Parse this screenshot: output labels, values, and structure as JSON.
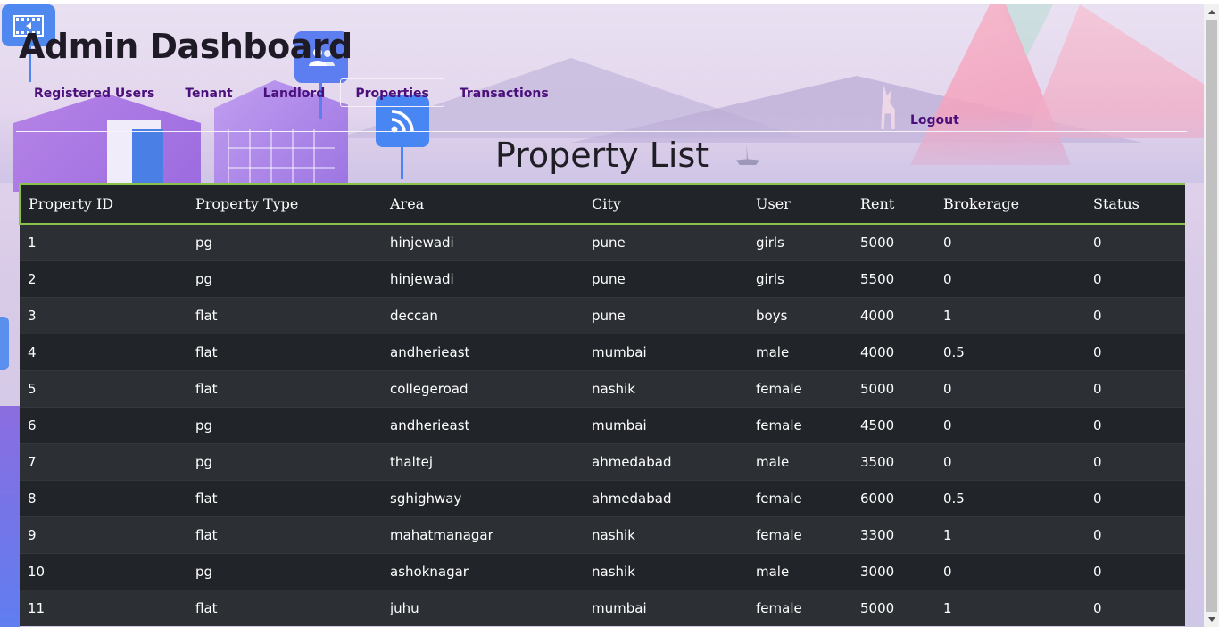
{
  "header": {
    "title": "Admin Dashboard",
    "nav": [
      {
        "label": "Registered Users",
        "active": false
      },
      {
        "label": "Tenant",
        "active": false
      },
      {
        "label": "Landlord",
        "active": false
      },
      {
        "label": "Properties",
        "active": true
      },
      {
        "label": "Transactions",
        "active": false
      }
    ],
    "logout_label": "Logout"
  },
  "main": {
    "page_title": "Property List",
    "table": {
      "columns": [
        "Property ID",
        "Property Type",
        "Area",
        "City",
        "User",
        "Rent",
        "Brokerage",
        "Status"
      ],
      "rows": [
        [
          "1",
          "pg",
          "hinjewadi",
          "pune",
          "girls",
          "5000",
          "0",
          "0"
        ],
        [
          "2",
          "pg",
          "hinjewadi",
          "pune",
          "girls",
          "5500",
          "0",
          "0"
        ],
        [
          "3",
          "flat",
          "deccan",
          "pune",
          "boys",
          "4000",
          "1",
          "0"
        ],
        [
          "4",
          "flat",
          "andherieast",
          "mumbai",
          "male",
          "4000",
          "0.5",
          "0"
        ],
        [
          "5",
          "flat",
          "collegeroad",
          "nashik",
          "female",
          "5000",
          "0",
          "0"
        ],
        [
          "6",
          "pg",
          "andherieast",
          "mumbai",
          "female",
          "4500",
          "0",
          "0"
        ],
        [
          "7",
          "pg",
          "thaltej",
          "ahmedabad",
          "male",
          "3500",
          "0",
          "0"
        ],
        [
          "8",
          "flat",
          "sghighway",
          "ahmedabad",
          "female",
          "6000",
          "0.5",
          "0"
        ],
        [
          "9",
          "flat",
          "mahatmanagar",
          "nashik",
          "female",
          "3300",
          "1",
          "0"
        ],
        [
          "10",
          "pg",
          "ashoknagar",
          "nashik",
          "male",
          "3000",
          "0",
          "0"
        ],
        [
          "11",
          "flat",
          "juhu",
          "mumbai",
          "female",
          "5000",
          "1",
          "0"
        ]
      ]
    }
  },
  "theme": {
    "nav_text_color": "#4a0f7a",
    "table_header_border": "#8bc34a",
    "table_bg_dark": "#212529",
    "table_bg_striped": "#2c3034"
  },
  "icons": [
    "film-icon",
    "users-icon",
    "rss-icon"
  ]
}
